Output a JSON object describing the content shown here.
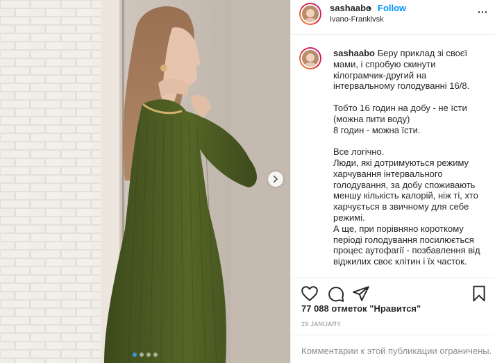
{
  "post": {
    "author": {
      "username": "sashaabo",
      "separator": "•",
      "follow_label": "Follow",
      "location": "Ivano-Frankivsk"
    },
    "caption": {
      "username": "sashaabo",
      "text": " Беру приклад зі своєї мами, і спробую скинути кілограмчик-другий на інтервальному голодуванні 16/8.\n\nТобто 16 годин на добу - не їсти (можна пити воду)\n8 годин - можна їсти.\n\nВсе логічно.\nЛюди, які дотримуються режиму харчування інтервального голодування, за добу споживають меншу кількість калорій, ніж ті, хто харчується в звичному для себе режимі.\nА ще, при порівняно короткому періоді голодування посилюється процес аутофагії - позбавлення від віджилих своє клітин і їх часток."
    },
    "likes_text": "77 088 отметок \"Нравится\"",
    "date": "29 JANUARY",
    "comments_disabled": "Комментарии к этой публикации ограничены.",
    "carousel": {
      "slides": 4,
      "active_index": 0
    },
    "icons": {
      "more": "more-options-icon",
      "like": "heart-icon",
      "comment": "comment-icon",
      "share": "paper-plane-icon",
      "save": "bookmark-icon",
      "next": "chevron-right-icon"
    },
    "colors": {
      "accent": "#0095f6",
      "text": "#262626",
      "muted": "#8e8e8e",
      "border": "#efefef",
      "dress": "#4b5a24"
    }
  }
}
